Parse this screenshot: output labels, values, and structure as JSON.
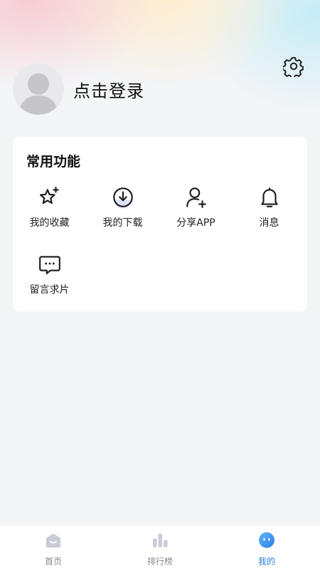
{
  "header": {
    "settings_icon": "gear-icon",
    "login_text": "点击登录",
    "avatar_icon": "default-avatar-icon"
  },
  "functions": {
    "title": "常用功能",
    "items": [
      {
        "label": "我的收藏",
        "icon": "star-sparkle-icon"
      },
      {
        "label": "我的下载",
        "icon": "download-icon"
      },
      {
        "label": "分享APP",
        "icon": "add-user-icon"
      },
      {
        "label": "消息",
        "icon": "bell-icon"
      },
      {
        "label": "留言求片",
        "icon": "chat-bubble-icon"
      }
    ]
  },
  "tabbar": {
    "tabs": [
      {
        "label": "首页",
        "icon": "home-icon",
        "active": false
      },
      {
        "label": "排行榜",
        "icon": "ranking-bars-icon",
        "active": false
      },
      {
        "label": "我的",
        "icon": "smiley-face-icon",
        "active": true
      }
    ]
  },
  "colors": {
    "accent": "#2a7fe0",
    "inactive_icon": "#c9ccd6",
    "background": "#f4f5f7"
  }
}
